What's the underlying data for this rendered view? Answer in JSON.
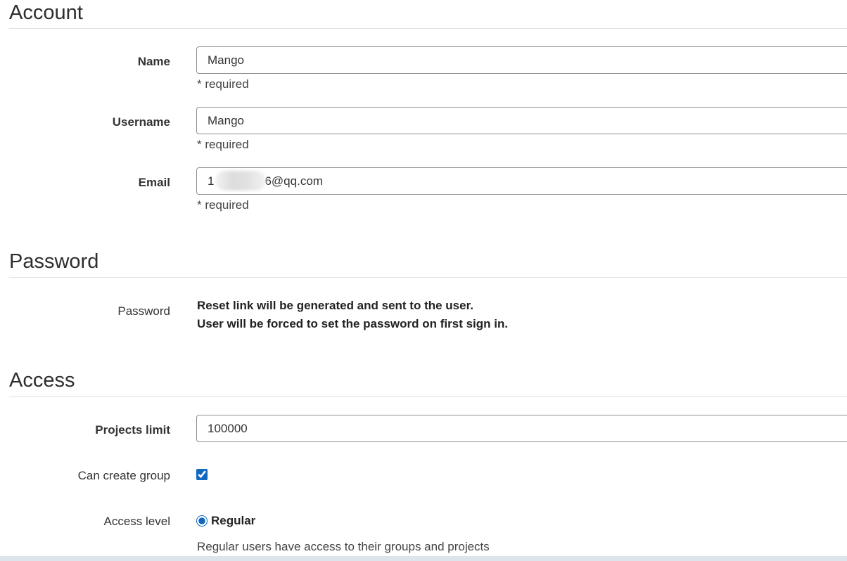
{
  "account": {
    "title": "Account",
    "name": {
      "label": "Name",
      "value": "Mango",
      "help": "* required"
    },
    "username": {
      "label": "Username",
      "value": "Mango",
      "help": "* required"
    },
    "email": {
      "label": "Email",
      "prefix": "1",
      "suffix": "6@qq.com",
      "help": "* required"
    }
  },
  "password": {
    "title": "Password",
    "label": "Password",
    "note_line1": "Reset link will be generated and sent to the user.",
    "note_line2": "User will be forced to set the password on first sign in."
  },
  "access": {
    "title": "Access",
    "projects_limit": {
      "label": "Projects limit",
      "value": "100000"
    },
    "can_create_group": {
      "label": "Can create group",
      "checked": true
    },
    "access_level": {
      "label": "Access level",
      "selected_option": "Regular",
      "help": "Regular users have access to their groups and projects"
    }
  },
  "colors": {
    "accent": "#1068bf",
    "input_border": "#8f8f8f",
    "rule": "#e1e1e1"
  }
}
